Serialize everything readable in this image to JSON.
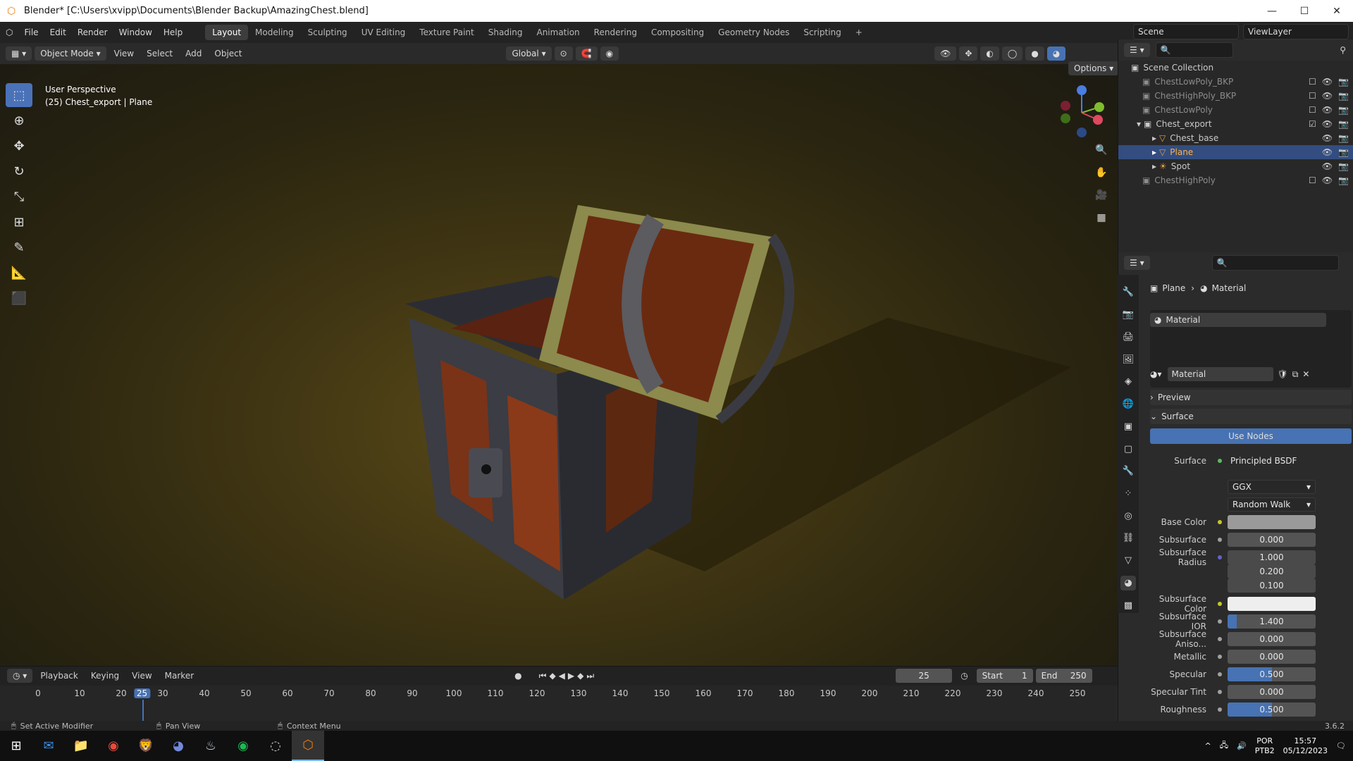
{
  "window": {
    "title": "Blender* [C:\\Users\\xvipp\\Documents\\Blender Backup\\AmazingChest.blend]"
  },
  "menus": [
    "File",
    "Edit",
    "Render",
    "Window",
    "Help"
  ],
  "workspaces": [
    "Layout",
    "Modeling",
    "Sculpting",
    "UV Editing",
    "Texture Paint",
    "Shading",
    "Animation",
    "Rendering",
    "Compositing",
    "Geometry Nodes",
    "Scripting"
  ],
  "topright": {
    "scene": "Scene",
    "viewlayer": "ViewLayer"
  },
  "viewport_header": {
    "mode": "Object Mode",
    "menus": [
      "View",
      "Select",
      "Add",
      "Object"
    ],
    "orientation": "Global",
    "options": "Options"
  },
  "viewport": {
    "perspective": "User Perspective",
    "context": "(25) Chest_export | Plane"
  },
  "outliner": {
    "root": "Scene Collection",
    "items": [
      {
        "name": "ChestLowPoly_BKP"
      },
      {
        "name": "ChestHighPoly_BKP"
      },
      {
        "name": "ChestLowPoly"
      },
      {
        "name": "Chest_export"
      },
      {
        "name": "Chest_base"
      },
      {
        "name": "Plane"
      },
      {
        "name": "Spot"
      },
      {
        "name": "ChestHighPoly"
      }
    ]
  },
  "properties": {
    "breadcrumb": [
      "Plane",
      "Material"
    ],
    "slot": "Material",
    "material_name": "Material",
    "preview": "Preview",
    "surface_section": "Surface",
    "use_nodes": "Use Nodes",
    "surface_label": "Surface",
    "surface_shader": "Principled BSDF",
    "distribution": "GGX",
    "subsurface_method": "Random Walk",
    "fields": [
      {
        "label": "Base Color",
        "value": ""
      },
      {
        "label": "Subsurface",
        "value": "0.000"
      },
      {
        "label": "Subsurface Radius",
        "value": "1.000"
      },
      {
        "label": "",
        "value": "0.200"
      },
      {
        "label": "",
        "value": "0.100"
      },
      {
        "label": "Subsurface Color",
        "value": ""
      },
      {
        "label": "Subsurface IOR",
        "value": "1.400"
      },
      {
        "label": "Subsurface Aniso...",
        "value": "0.000"
      },
      {
        "label": "Metallic",
        "value": "0.000"
      },
      {
        "label": "Specular",
        "value": "0.500"
      },
      {
        "label": "Specular Tint",
        "value": "0.000"
      },
      {
        "label": "Roughness",
        "value": "0.500"
      }
    ]
  },
  "timeline": {
    "menus": [
      "Playback",
      "Keying",
      "View",
      "Marker"
    ],
    "current_frame": "25",
    "start_label": "Start",
    "start": "1",
    "end_label": "End",
    "end": "250",
    "ticks": [
      "0",
      "10",
      "20",
      "25",
      "30",
      "40",
      "50",
      "60",
      "70",
      "80",
      "90",
      "100",
      "110",
      "120",
      "130",
      "140",
      "150",
      "160",
      "170",
      "180",
      "190",
      "200",
      "210",
      "220",
      "230",
      "240",
      "250"
    ]
  },
  "statusbar": {
    "left": "Set Active Modifier",
    "mid": "Pan View",
    "right": "Context Menu",
    "version": "3.6.2"
  },
  "taskbar": {
    "lang1": "POR",
    "lang2": "PTB2",
    "time": "15:57",
    "date": "05/12/2023"
  }
}
